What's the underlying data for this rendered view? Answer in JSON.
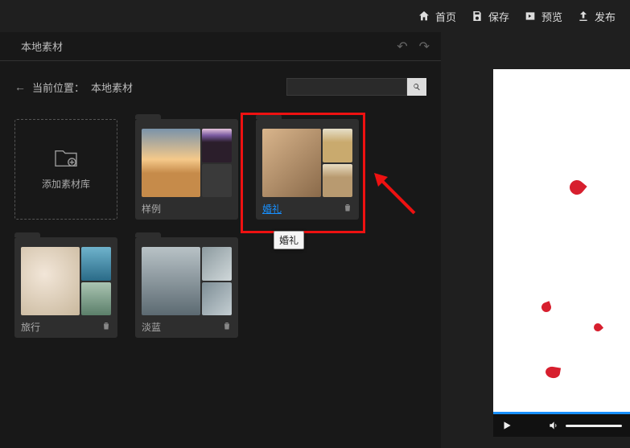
{
  "topbar": {
    "home": "首页",
    "save": "保存",
    "preview": "预览",
    "publish": "发布"
  },
  "tabs": {
    "local": "本地素材"
  },
  "breadcrumb": {
    "label": "当前位置：",
    "current": "本地素材"
  },
  "search": {
    "placeholder": ""
  },
  "addCard": {
    "label": "添加素材库"
  },
  "folders": [
    {
      "name": "样例",
      "deletable": false,
      "thumbs": [
        "g-sunset",
        "g-mountain",
        ""
      ]
    },
    {
      "name": "婚礼",
      "deletable": true,
      "selected": true,
      "thumbs": [
        "g-couple",
        "g-field",
        "g-wed"
      ]
    },
    {
      "name": "旅行",
      "deletable": true,
      "thumbs": [
        "g-kids",
        "g-ocean",
        "g-bay"
      ]
    },
    {
      "name": "淡蓝",
      "deletable": true,
      "thumbs": [
        "g-road",
        "g-girl1",
        "g-girl2"
      ]
    }
  ],
  "tooltip": "婚礼",
  "icons": {
    "home": "home-icon",
    "save": "save-icon",
    "preview": "preview-icon",
    "publish": "upload-icon",
    "search": "search-icon",
    "back": "back-arrow-icon",
    "undo": "undo-icon",
    "redo": "redo-icon",
    "delete": "trash-icon",
    "addlib": "folder-plus-icon",
    "play": "play-icon",
    "volume": "volume-icon"
  }
}
